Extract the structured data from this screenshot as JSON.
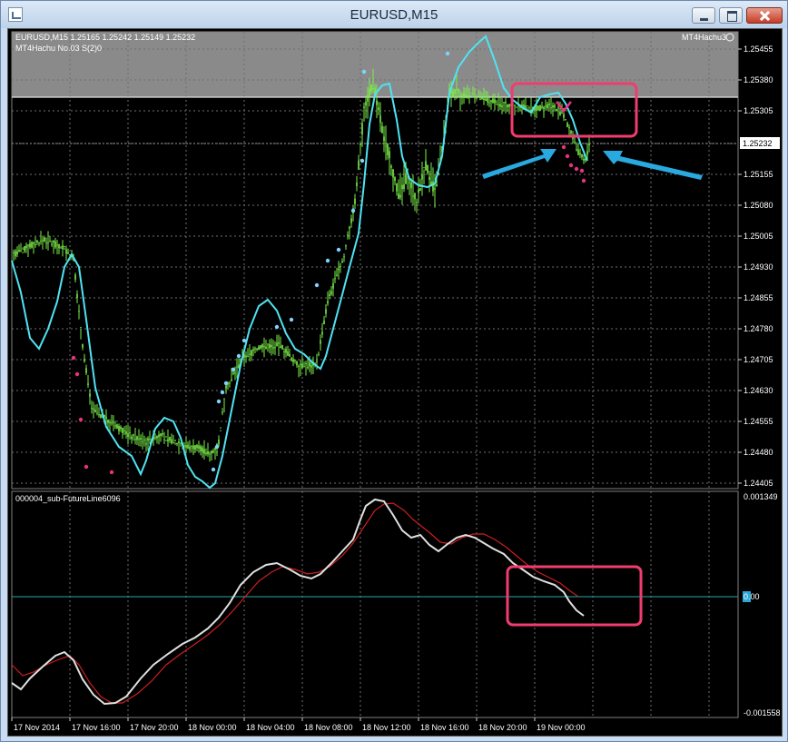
{
  "window": {
    "title": "EURUSD,M15"
  },
  "chart": {
    "symbol_line": "EURUSD,M15  1.25165 1.25242 1.25149 1.25232",
    "indicator_line": "MT4Hachu  No.03  S(2)0",
    "top_right_label": "MT4Hachu3",
    "current_price": "1.25232",
    "price_ticks": [
      "1.25455",
      "1.25380",
      "1.25305",
      "1.25232",
      "1.25155",
      "1.25080",
      "1.25005",
      "1.24930",
      "1.24855",
      "1.24780",
      "1.24705",
      "1.24630",
      "1.24555",
      "1.24480",
      "1.24405"
    ],
    "sub_title": "000004_sub-FutureLine6096",
    "sub_ticks": [
      "0.001349",
      "0.00",
      "-0.001558"
    ],
    "time_labels": [
      "17 Nov 2014",
      "17 Nov 16:00",
      "17 Nov 20:00",
      "18 Nov 00:00",
      "18 Nov 04:00",
      "18 Nov 08:00",
      "18 Nov 12:00",
      "18 Nov 16:00",
      "18 Nov 20:00",
      "19 Nov 00:00"
    ]
  },
  "colors": {
    "candles": "#7cf04a",
    "moving_average": "#4fe3f2",
    "dots_up": "#7fd3ff",
    "dots_down": "#e8327e",
    "highlight_box": "#f03c6e",
    "arrow": "#29a9e0",
    "sub_white": "#e8e8e8",
    "sub_red": "#cc1f1f"
  }
}
